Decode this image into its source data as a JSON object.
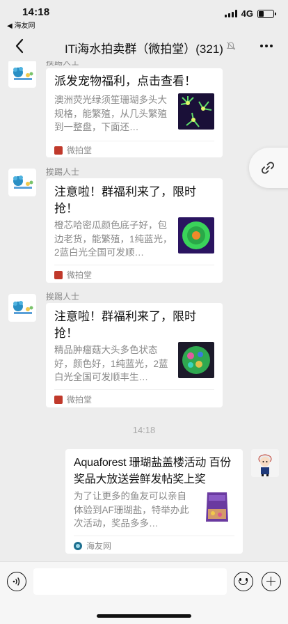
{
  "status_bar": {
    "time": "14:18",
    "back_app": "◀ 海友网",
    "network": "4G",
    "battery_level": 0.35
  },
  "nav": {
    "title": "ITi海水拍卖群（微拍堂）(321)"
  },
  "messages": [
    {
      "sender": "挨踢人士",
      "title": "派发宠物福利，点击查看！",
      "desc": "澳洲荧光绿须笙珊瑚多头大规格，能繁殖，从几头繁殖到一整盘，下面还…",
      "source": "微拍堂",
      "thumb": "green-coral-thumbnail"
    },
    {
      "sender": "挨踢人士",
      "title": "注意啦！群福利来了，限时抢！",
      "desc": "橙芯哈密瓜颜色底子好，包边老货，能繁殖，1纯蓝光，2蓝白光全国可发顺…",
      "source": "微拍堂",
      "thumb": "orange-coral-thumbnail"
    },
    {
      "sender": "挨踢人士",
      "title": "注意啦！群福利来了，限时抢！",
      "desc": "精品肿瘤菇大头多色状态好，颜色好，1纯蓝光，2蓝白光全国可发顺丰生…",
      "source": "微拍堂",
      "thumb": "mushroom-coral-thumbnail"
    }
  ],
  "time_separator": "14:18",
  "my_message": {
    "title": "Aquaforest 珊瑚盐盖楼活动 百份奖品大放送尝鲜发帖奖上奖",
    "desc": "为了让更多的鱼友可以亲自体验到AF珊瑚盐，特举办此次活动，奖品多多…",
    "source": "海友网",
    "thumb": "salt-bag-thumbnail"
  },
  "input": {
    "placeholder": ""
  },
  "colors": {
    "background": "#ededed",
    "card": "#ffffff",
    "source_red": "#c0392b",
    "muted": "#888888"
  }
}
